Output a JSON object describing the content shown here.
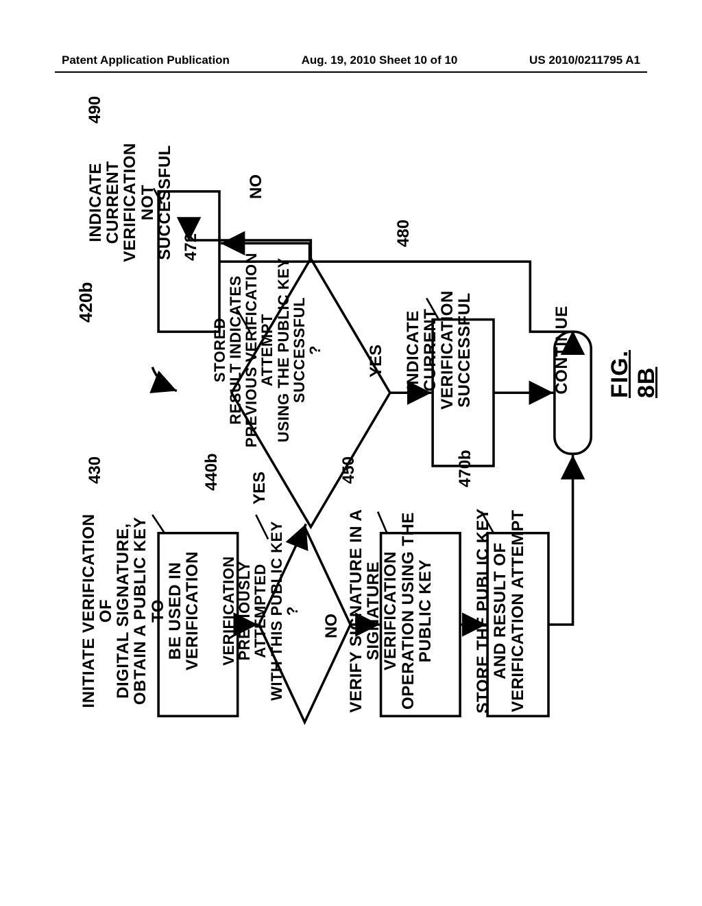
{
  "header": {
    "left": "Patent Application Publication",
    "mid": "Aug. 19, 2010  Sheet 10 of 10",
    "right": "US 2010/0211795 A1"
  },
  "refs": {
    "r420b": "420b",
    "r430": "430",
    "r440b": "440b",
    "r450": "450",
    "r470b": "470b",
    "r472": "472",
    "r480": "480",
    "r490": "490"
  },
  "nodes": {
    "n430": "INITIATE VERIFICATION OF\nDIGITAL SIGNATURE,\nOBTAIN A PUBLIC KEY TO\nBE USED IN VERIFICATION",
    "n440b": "VERIFICATION\nPREVIOUSLY ATTEMPTED\nWITH THIS PUBLIC KEY\n?",
    "n450": "VERIFY SIGNATURE IN A\nSIGNATURE VERIFICATION\nOPERATION USING THE\nPUBLIC KEY",
    "n470b": "STORE THE PUBLIC KEY\nAND RESULT OF\nVERIFICATION ATTEMPT",
    "n472": "STORED\nRESULT INDICATES\nPREVIOUS VERIFICATION ATTEMPT\nUSING THE PUBLIC KEY\nSUCCESSFUL\n?",
    "n480": "INDICATE CURRENT\nVERIFICATION\nSUCCESSFUL",
    "n490": "INDICATE CURRENT\nVERIFICATION NOT\nSUCCESSFUL",
    "continue": "CONTINUE"
  },
  "edges": {
    "yes": "YES",
    "no": "NO"
  },
  "figure_caption": "FIG. 8B"
}
